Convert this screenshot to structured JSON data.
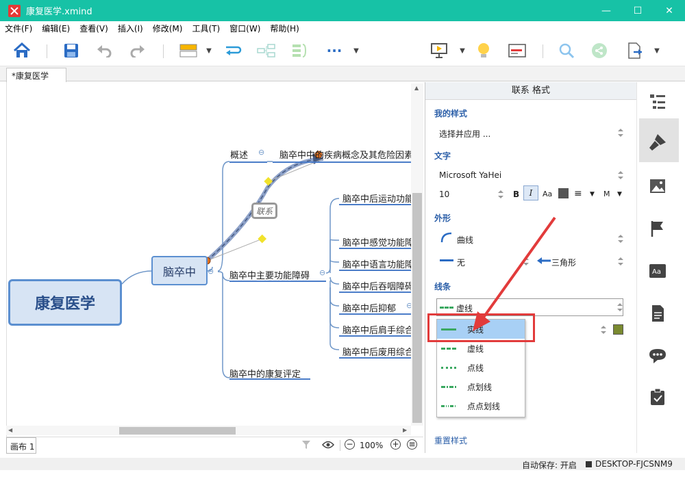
{
  "window": {
    "title": "康复医学.xmind",
    "minimize": "—",
    "maximize": "☐",
    "close": "✕"
  },
  "menu": [
    "文件(F)",
    "编辑(E)",
    "查看(V)",
    "插入(I)",
    "修改(M)",
    "工具(T)",
    "窗口(W)",
    "帮助(H)"
  ],
  "tab": "*康复医学",
  "map": {
    "central": "康复医学",
    "main": "脑卒中",
    "branches": [
      "概述",
      "脑卒中主要功能障碍",
      "脑卒中的康复评定"
    ],
    "topic_overview": "脑卒中中的疾病概念及其危险因素",
    "sub_topics": [
      "脑卒中后运动功能",
      "脑卒中感觉功能障",
      "脑卒中语言功能障",
      "脑卒中后吞咽障碍",
      "脑卒中后抑郁",
      "脑卒中后肩手综合",
      "脑卒中后废用综合"
    ],
    "relation_label": "联系",
    "collapse_glyph": "⊖"
  },
  "bottom": {
    "sheet": "画布 1",
    "zoom": "100%"
  },
  "panel": {
    "title": "联系 格式",
    "my_style": "我的样式",
    "style_select": "选择并应用 ...",
    "text": "文字",
    "font": "Microsoft YaHei",
    "size": "10",
    "bold": "B",
    "italic": "I",
    "aa": "Aa",
    "align": "≡",
    "m": "M",
    "shape": "外形",
    "curve": "曲线",
    "none": "无",
    "triangle": "三角形",
    "line": "线条",
    "line_current": "虚线",
    "options": [
      "实线",
      "虚线",
      "点线",
      "点划线",
      "点点划线"
    ],
    "reset": "重置样式"
  },
  "status": {
    "autosave": "自动保存: 开启",
    "user": "DESKTOP-FJCSNM9"
  },
  "colors": {
    "titlebar": "#17c2a6",
    "accent": "#2a5ea8",
    "highlight": "#a8d0f5",
    "annotation": "#e23b3b",
    "line_color": "#7a8a30"
  }
}
